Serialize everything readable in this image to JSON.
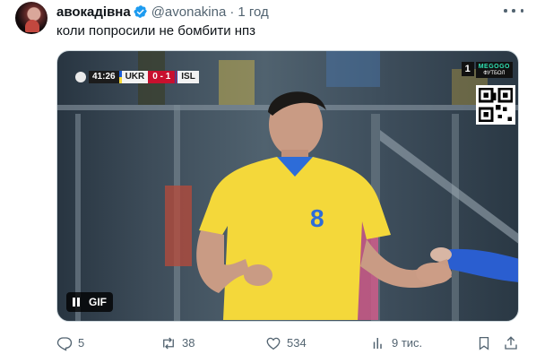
{
  "tweet": {
    "display_name": "авокадівна",
    "handle": "@avonakina",
    "separator": "·",
    "time": "1 год",
    "text": "коли попросили не бомбити нпз"
  },
  "media": {
    "scorebug": {
      "clock": "41:26",
      "home_team": "UKR",
      "score": "0 - 1",
      "away_team": "ISL"
    },
    "channel": {
      "number": "1",
      "name": "MEGOGO",
      "sub": "ФУТБОЛ"
    },
    "player_number": "8",
    "gif_label": "GIF"
  },
  "actions": {
    "replies": "5",
    "reposts": "38",
    "likes": "534",
    "views": "9 тис."
  },
  "colors": {
    "verified": "#1d9bf0",
    "secondary_text": "#536471",
    "jersey_yellow": "#f4d83a",
    "score_red": "#c8102e"
  },
  "icons": [
    "verified-icon",
    "more-icon",
    "pause-icon",
    "reply-icon",
    "repost-icon",
    "like-icon",
    "views-icon",
    "bookmark-icon",
    "share-icon"
  ]
}
